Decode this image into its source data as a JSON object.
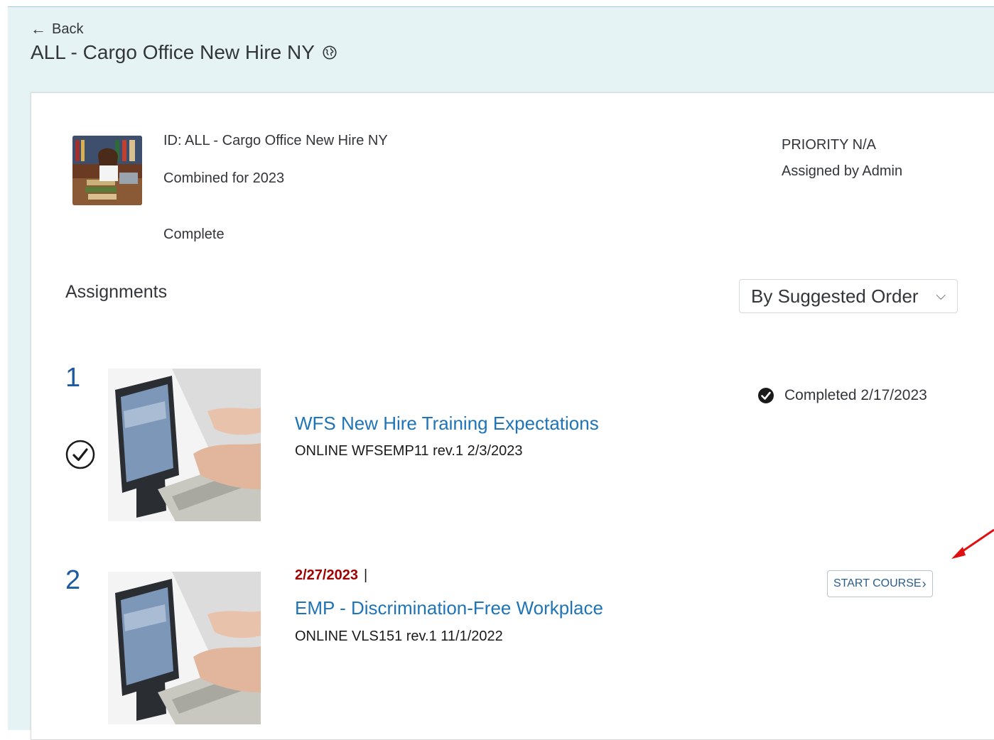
{
  "header": {
    "back_label": "Back",
    "title": "ALL - Cargo Office New Hire NY"
  },
  "summary": {
    "id_line": "ID: ALL - Cargo Office New Hire NY",
    "combined_line": "Combined for 2023",
    "status": "Complete",
    "priority": "PRIORITY N/A",
    "assigned_by": "Assigned by Admin"
  },
  "assignments": {
    "heading": "Assignments",
    "sort_label": "By Suggested Order",
    "items": [
      {
        "number": "1",
        "title": "WFS New Hire Training Expectations",
        "subtitle": "ONLINE WFSEMP11 rev.1 2/3/2023",
        "completed_label": "Completed 2/17/2023"
      },
      {
        "number": "2",
        "due_date": "2/27/2023",
        "due_separator": "|",
        "title": "EMP - Discrimination-Free Workplace",
        "subtitle": "ONLINE VLS151 rev.1 11/1/2022",
        "action_label": "START COURSE"
      }
    ]
  },
  "colors": {
    "link": "#1f74b8",
    "number": "#1e5aa0",
    "due": "#a00000",
    "page_bg": "#e6f3f5",
    "annotation": "#e01010"
  }
}
